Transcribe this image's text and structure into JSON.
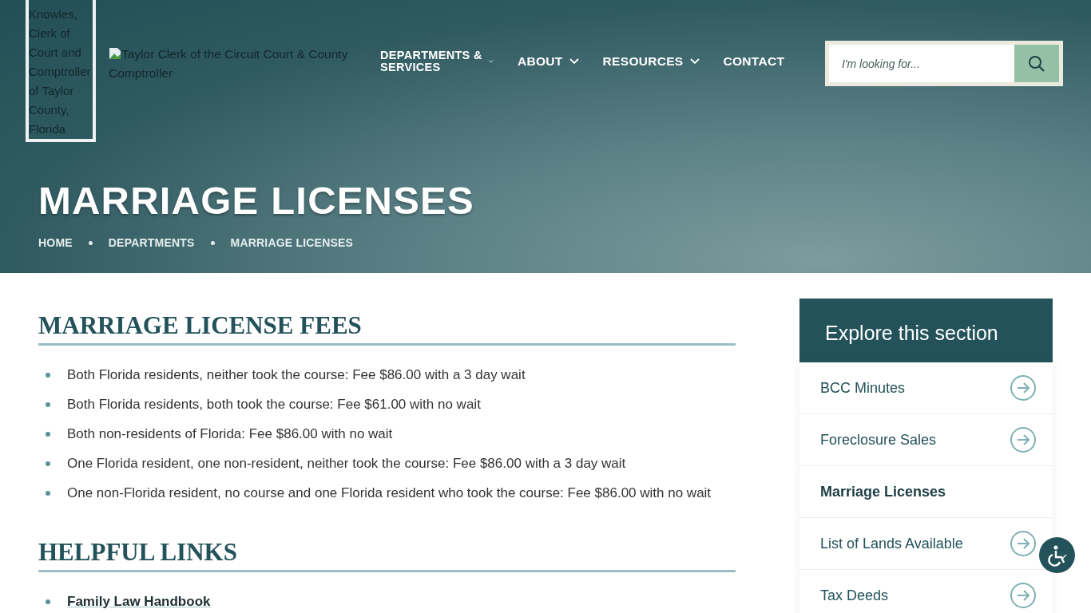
{
  "header": {
    "logo_alt": "Knowles, Clerk of Court and Comptroller of Taylor County, Florida",
    "site_alt": "Taylor Clerk of the Circuit Court & County Comptroller",
    "nav": [
      {
        "label": "DEPARTMENTS & SERVICES",
        "dropdown": true,
        "small_caret": true
      },
      {
        "label": "ABOUT",
        "dropdown": true,
        "small_caret": false
      },
      {
        "label": "RESOURCES",
        "dropdown": true,
        "small_caret": false
      },
      {
        "label": "CONTACT",
        "dropdown": false,
        "small_caret": false
      }
    ],
    "search": {
      "placeholder": "I'm looking for..."
    }
  },
  "hero": {
    "title": "MARRIAGE LICENSES",
    "breadcrumb": [
      "HOME",
      "DEPARTMENTS",
      "MARRIAGE LICENSES"
    ]
  },
  "sections": [
    {
      "heading": "MARRIAGE LICENSE FEES",
      "items": [
        {
          "kind": "text",
          "text": "Both Florida residents, neither took the course: Fee $86.00 with a 3 day wait"
        },
        {
          "kind": "text",
          "text": "Both Florida residents, both took the course: Fee $61.00 with no wait"
        },
        {
          "kind": "text",
          "text": "Both non-residents of Florida: Fee $86.00 with no wait"
        },
        {
          "kind": "text",
          "text": "One Florida resident, one non-resident, neither took the course: Fee $86.00 with a 3 day wait"
        },
        {
          "kind": "text",
          "text": "One non-Florida resident, no course and one Florida resident who took the course: Fee $86.00 with no wait"
        }
      ]
    },
    {
      "heading": "HELPFUL LINKS",
      "items": [
        {
          "kind": "link",
          "text": "Family Law Handbook"
        }
      ]
    }
  ],
  "sidebar": {
    "title": "Explore this section",
    "items": [
      {
        "label": "BCC Minutes",
        "selected": false
      },
      {
        "label": "Foreclosure Sales",
        "selected": false
      },
      {
        "label": "Marriage Licenses",
        "selected": true
      },
      {
        "label": "List of Lands Available",
        "selected": false
      },
      {
        "label": "Tax Deeds",
        "selected": false
      }
    ]
  }
}
